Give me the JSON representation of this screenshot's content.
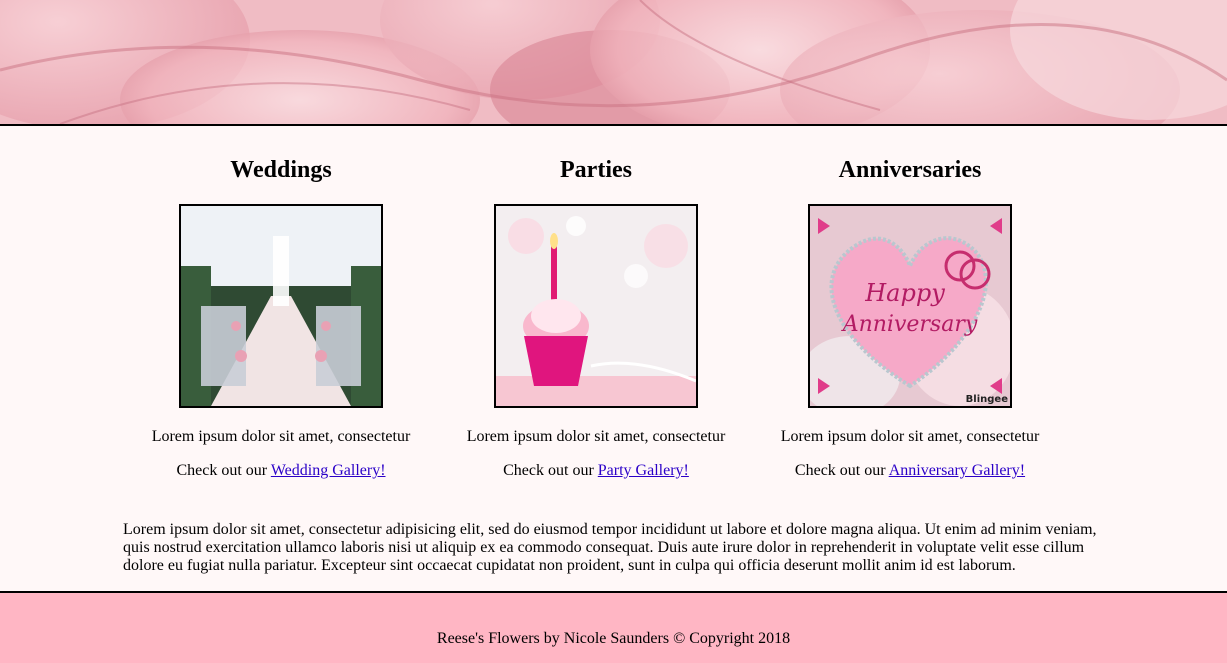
{
  "columns": [
    {
      "heading": "Weddings",
      "description": "Lorem ipsum dolor sit amet, consectetur",
      "gallery_prefix": "Check out our ",
      "gallery_link": "Wedding Gallery!"
    },
    {
      "heading": "Parties",
      "description": "Lorem ipsum dolor sit amet, consectetur",
      "gallery_prefix": "Check out our ",
      "gallery_link": "Party Gallery!"
    },
    {
      "heading": "Anniversaries",
      "description": "Lorem ipsum dolor sit amet, consectetur",
      "gallery_prefix": "Check out our ",
      "gallery_link": "Anniversary Gallery!"
    }
  ],
  "paragraph": "Lorem ipsum dolor sit amet, consectetur adipisicing elit, sed do eiusmod tempor incididunt ut labore et dolore magna aliqua. Ut enim ad minim veniam, quis nostrud exercitation ullamco laboris nisi ut aliquip ex ea commodo consequat. Duis aute irure dolor in reprehenderit in voluptate velit esse cillum dolore eu fugiat nulla pariatur. Excepteur sint occaecat cupidatat non proident, sunt in culpa qui officia deserunt mollit anim id est laborum.",
  "footer": {
    "text": "Reese's Flowers by Nicole Saunders © Copyright 2018"
  },
  "anniversary_image_text": {
    "line1": "Happy",
    "line2": "Anniversary",
    "watermark": "Blingee"
  },
  "colors": {
    "page_bg": "#fff8f8",
    "footer_bg": "#ffb6c4",
    "link": "#2a00c8",
    "rose_pink": "#f2b9c1"
  }
}
